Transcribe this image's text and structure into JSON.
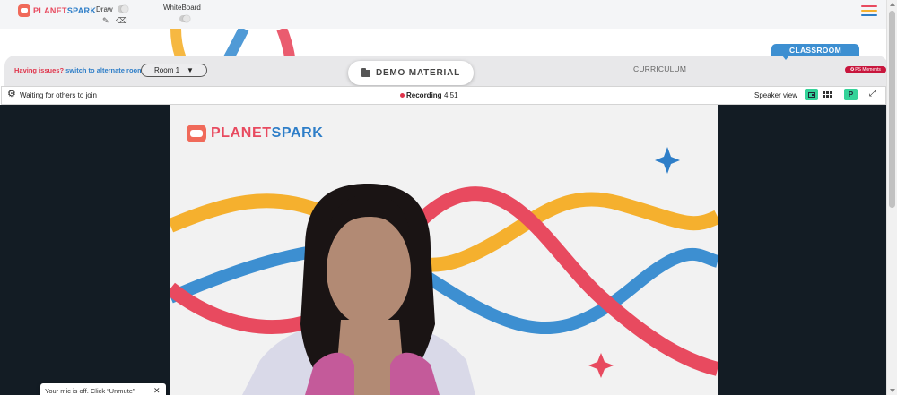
{
  "brand": {
    "planet": "PLANET",
    "spark": "SPARK"
  },
  "toolbar": {
    "draw_label": "Draw",
    "whiteboard_label": "WhiteBoard",
    "icons": [
      "pencil-icon",
      "eraser-icon",
      "menu-icon"
    ]
  },
  "tabs_bar": {
    "issue_red": "Having issues?",
    "issue_blue": "switch to alternate room",
    "room_select": "Room 1",
    "tabs": [
      {
        "label": "DEMO MATERIAL",
        "active": true
      },
      {
        "label": "CURRICULUM",
        "active": false
      },
      {
        "label": "CLASSROOM",
        "active": false
      }
    ],
    "moments_badge": "PS Moments"
  },
  "video_header": {
    "waiting": "Waiting for others to join",
    "recording_label": "Recording",
    "recording_time": "4:51",
    "speaker_view": "Speaker view",
    "participant_button": "P"
  },
  "video": {
    "logo_planet": "PLANET",
    "logo_spark": "SPARK"
  },
  "toast": {
    "mic_message": "Your mic is off. Click “Unmute”",
    "close": "✕"
  },
  "colors": {
    "brand_red": "#e84a5f",
    "brand_blue": "#2e7ec8",
    "brand_yellow": "#f5b02e",
    "accent_green": "#34d399",
    "video_bg": "#131c24"
  }
}
